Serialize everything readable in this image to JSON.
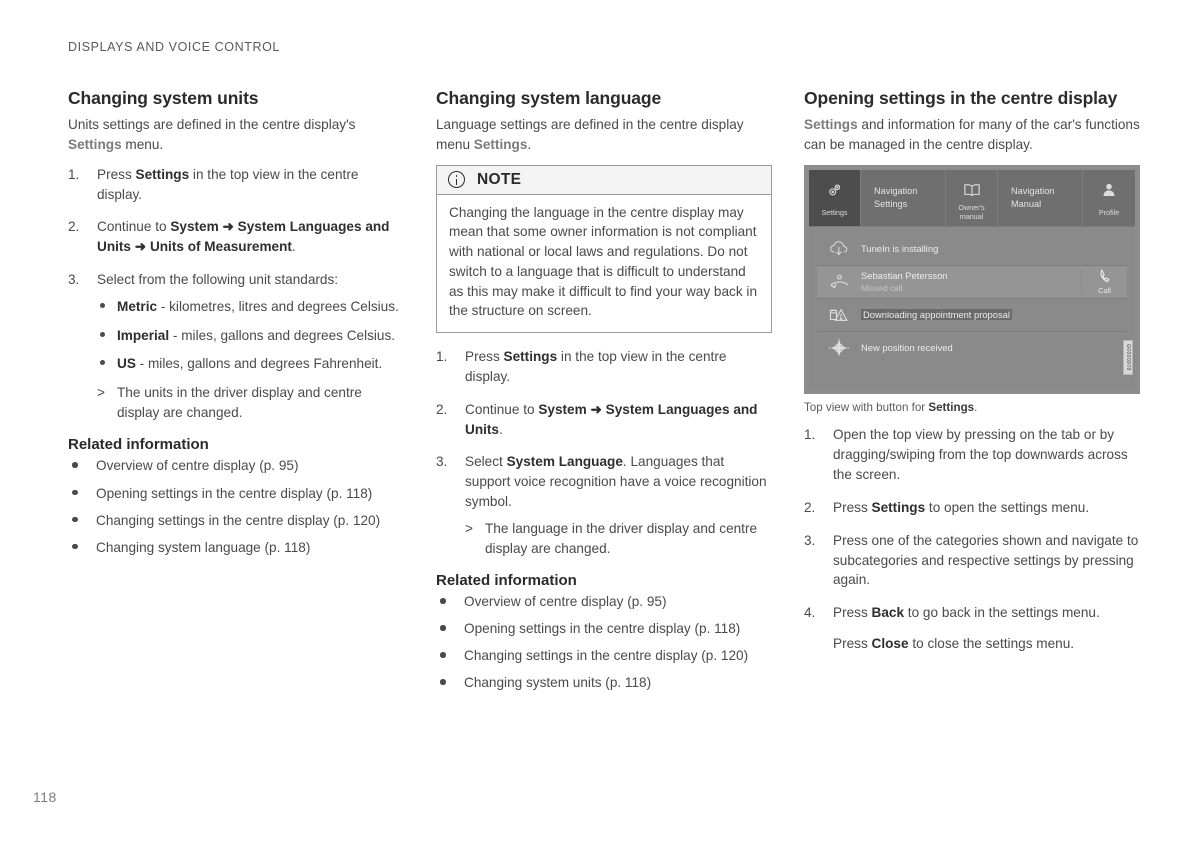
{
  "page": {
    "running_head": "DISPLAYS AND VOICE CONTROL",
    "folio": "118"
  },
  "column1": {
    "heading": "Changing system units",
    "intro_a": "Units settings are defined in the centre display's ",
    "intro_settings": "Settings",
    "intro_b": " menu.",
    "steps": [
      {
        "num": "1.",
        "parts": [
          {
            "t": "Press ",
            "b": false
          },
          {
            "t": "Settings",
            "b": true
          },
          {
            "t": " in the top view in the centre display.",
            "b": false
          }
        ]
      },
      {
        "num": "2.",
        "parts": [
          {
            "t": "Continue to ",
            "b": false
          },
          {
            "t": "System",
            "b": true
          },
          {
            "t": " ➜ ",
            "b": true
          },
          {
            "t": "System Languages and Units",
            "b": true
          },
          {
            "t": " ➜ ",
            "b": true
          },
          {
            "t": "Units of Measurement",
            "b": true
          },
          {
            "t": ".",
            "b": false
          }
        ]
      },
      {
        "num": "3.",
        "parts": [
          {
            "t": "Select from the following unit standards:",
            "b": false
          }
        ]
      }
    ],
    "unit_bullets": [
      {
        "bold": "Metric",
        "rest": " - kilometres, litres and degrees Celsius."
      },
      {
        "bold": "Imperial",
        "rest": " - miles, gallons and degrees Celsius."
      },
      {
        "bold": "US",
        "rest": " - miles, gallons and degrees Fahrenheit."
      }
    ],
    "result": "The units in the driver display and centre display are changed.",
    "related_heading": "Related information",
    "related": [
      "Overview of centre display (p. 95)",
      "Opening settings in the centre display (p. 118)",
      "Changing settings in the centre display (p. 120)",
      "Changing system language (p. 118)"
    ]
  },
  "column2": {
    "heading": "Changing system language",
    "intro_a": "Language settings are defined in the centre display menu ",
    "intro_settings": "Settings",
    "intro_b": ".",
    "note": {
      "title": "NOTE",
      "icon": "info-icon",
      "body": "Changing the language in the centre display may mean that some owner information is not compliant with national or local laws and regulations. Do not switch to a language that is difficult to understand as this may make it difficult to find your way back in the structure on screen."
    },
    "steps": [
      {
        "num": "1.",
        "parts": [
          {
            "t": "Press ",
            "b": false
          },
          {
            "t": "Settings",
            "b": true
          },
          {
            "t": " in the top view in the centre display.",
            "b": false
          }
        ]
      },
      {
        "num": "2.",
        "parts": [
          {
            "t": "Continue to ",
            "b": false
          },
          {
            "t": "System",
            "b": true
          },
          {
            "t": " ➜ ",
            "b": true
          },
          {
            "t": "System Languages and Units",
            "b": true
          },
          {
            "t": ".",
            "b": false
          }
        ]
      },
      {
        "num": "3.",
        "parts": [
          {
            "t": "Select ",
            "b": false
          },
          {
            "t": "System Language",
            "b": true
          },
          {
            "t": ". Languages that support voice recognition have a voice recognition symbol.",
            "b": false
          }
        ]
      }
    ],
    "result": "The language in the driver display and centre display are changed.",
    "related_heading": "Related information",
    "related": [
      "Overview of centre display (p. 95)",
      "Opening settings in the centre display (p. 118)",
      "Changing settings in the centre display (p. 120)",
      "Changing system units (p. 118)"
    ]
  },
  "column3": {
    "heading": "Opening settings in the centre display",
    "intro_settings": "Settings",
    "intro_rest": " and information for many of the car's functions can be managed in the centre display.",
    "illustration": {
      "tabs": [
        {
          "label": "Settings",
          "icon": "settings-gear-icon",
          "active": true,
          "style": "icon"
        },
        {
          "label": "Navigation Settings",
          "icon": "",
          "active": false,
          "style": "text"
        },
        {
          "label": "Owner's manual",
          "icon": "book-icon",
          "active": false,
          "style": "icon"
        },
        {
          "label": "Navigation Manual",
          "icon": "",
          "active": false,
          "style": "text"
        },
        {
          "label": "Profile",
          "icon": "person-icon",
          "active": false,
          "style": "icon"
        }
      ],
      "notifications": [
        {
          "icon": "cloud-download-icon",
          "title": "TuneIn is installing",
          "subtitle": "",
          "action": "",
          "action_icon": "",
          "highlight": false
        },
        {
          "icon": "missed-call-icon",
          "title": "Sebastian Petersson",
          "subtitle": "Missed call",
          "action": "Call",
          "action_icon": "phone-icon",
          "highlight": true
        },
        {
          "icon": "warning-calendar-icon",
          "title": "Downloading appointment proposal",
          "subtitle": "",
          "action": "",
          "action_icon": "",
          "highlight": false
        },
        {
          "icon": "compass-icon",
          "title": "New position received",
          "subtitle": "",
          "action": "",
          "action_icon": "",
          "highlight": false
        }
      ],
      "image_code": "G0000978"
    },
    "caption_a": "Top view with button for ",
    "caption_bold": "Settings",
    "caption_b": ".",
    "steps": [
      {
        "num": "1.",
        "parts": [
          {
            "t": "Open the top view by pressing on the tab or by dragging/swiping from the top downwards across the screen.",
            "b": false
          }
        ]
      },
      {
        "num": "2.",
        "parts": [
          {
            "t": "Press ",
            "b": false
          },
          {
            "t": "Settings",
            "b": true
          },
          {
            "t": " to open the settings menu.",
            "b": false
          }
        ]
      },
      {
        "num": "3.",
        "parts": [
          {
            "t": "Press one of the categories shown and navigate to subcategories and respective settings by pressing again.",
            "b": false
          }
        ]
      },
      {
        "num": "4.",
        "parts": [
          {
            "t": "Press ",
            "b": false
          },
          {
            "t": "Back",
            "b": true
          },
          {
            "t": " to go back in the settings menu.",
            "b": false
          }
        ]
      }
    ],
    "step4_extra": [
      {
        "t": "Press ",
        "b": false
      },
      {
        "t": "Close",
        "b": true
      },
      {
        "t": " to close the settings menu.",
        "b": false
      }
    ]
  },
  "colors": {
    "body_text": "#4a4a4a",
    "heading": "#2b2b2b",
    "gray_ref": "#7b7b7b",
    "screen_bg": "#8a8a8a",
    "tab_bg": "#6f6f6f",
    "tab_active": "#4d4d4d"
  }
}
